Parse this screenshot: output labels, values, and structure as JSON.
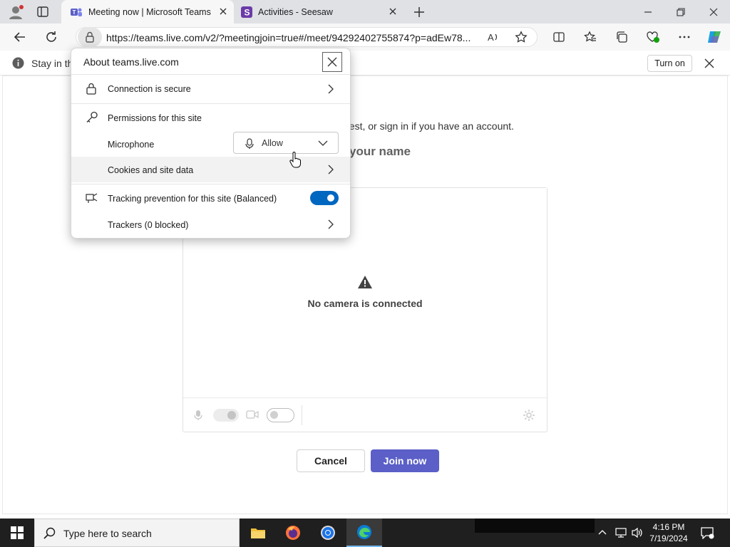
{
  "browser": {
    "tabs": [
      {
        "title": "Meeting now | Microsoft Teams",
        "icon": "teams-icon",
        "active": true
      },
      {
        "title": "Activities - Seesaw",
        "icon": "seesaw-icon",
        "active": false
      }
    ],
    "url": "https://teams.live.com/v2/?meetingjoin=true#/meet/94292402755874?p=adEw78..."
  },
  "infobar": {
    "text": "Stay in th",
    "turn_on_label": "Turn on"
  },
  "site_info_flyout": {
    "title": "About teams.live.com",
    "connection_label": "Connection is secure",
    "permissions_label": "Permissions for this site",
    "microphone_label": "Microphone",
    "microphone_value": "Allow",
    "cookies_label": "Cookies and site data",
    "tracking_label": "Tracking prevention for this site (Balanced)",
    "tracking_enabled": true,
    "trackers_label": "Trackers (0 blocked)"
  },
  "page": {
    "guest_text": "uest, or sign in if you have an account.",
    "name_heading": "your name",
    "camera_message": "No camera is connected",
    "cancel_label": "Cancel",
    "join_label": "Join now"
  },
  "taskbar": {
    "search_placeholder": "Type here to search",
    "time": "4:16 PM",
    "date": "7/19/2024"
  },
  "colors": {
    "accent": "#0067c0",
    "teams_purple": "#5b5fc7"
  }
}
